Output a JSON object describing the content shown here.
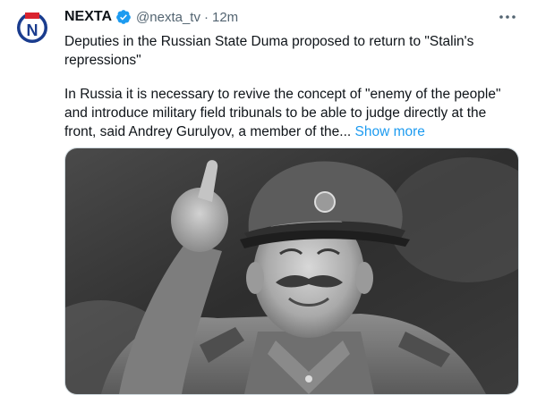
{
  "tweet": {
    "author_name": "NEXTA",
    "handle": "@nexta_tv",
    "separator": "·",
    "time": "12m",
    "headline": "Deputies in the Russian State Duma proposed to return to \"Stalin's repressions\"",
    "body": "In Russia it is necessary to revive the concept of \"enemy of the people\" and introduce military field tribunals to be able to judge directly at the front, said Andrey Gurulyov, a member of the...",
    "show_more": "Show more",
    "avatar_letter": "N",
    "icons": {
      "avatar": "nexta-logo-icon",
      "verified": "verified-badge-icon",
      "more": "more-options-icon"
    }
  },
  "colors": {
    "link": "#1d9bf0",
    "secondary_text": "#536471",
    "avatar_red": "#d9232e",
    "avatar_blue": "#1a3c8e"
  }
}
